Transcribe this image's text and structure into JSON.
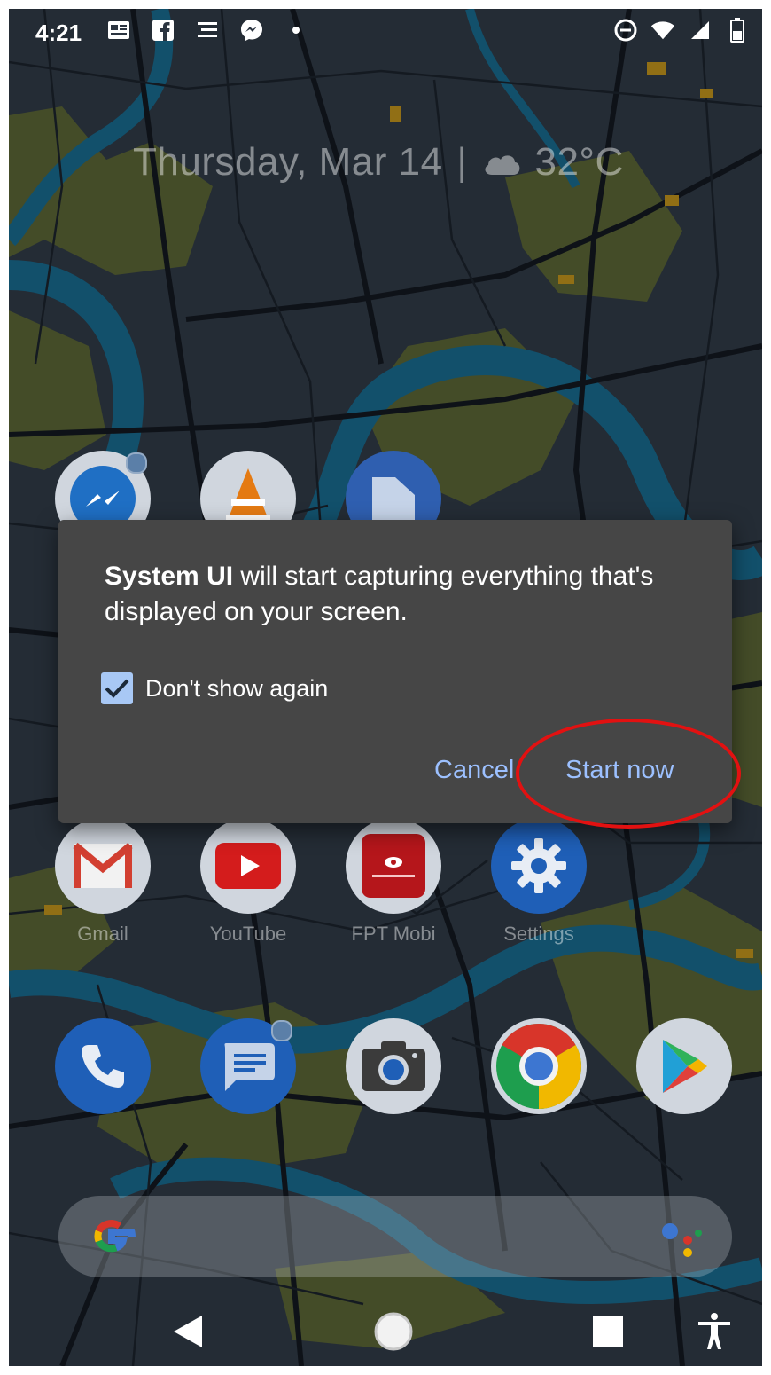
{
  "status_bar": {
    "time": "4:21",
    "left_icons": [
      "news-icon",
      "facebook-icon",
      "notes-icon",
      "messenger-icon",
      "dot-icon"
    ],
    "right_icons": [
      "do-not-disturb-icon",
      "wifi-icon",
      "signal-icon",
      "battery-icon"
    ]
  },
  "date_widget": {
    "date": "Thursday, Mar 14",
    "separator": "|",
    "weather_icon": "cloud-icon",
    "temperature": "32°C"
  },
  "apps": {
    "row1": [
      {
        "name": "Messenger",
        "icon": "messenger-icon",
        "color": "#1f6fc4"
      },
      {
        "name": "VLC",
        "icon": "vlc-icon",
        "color": "#d9d9d9"
      },
      {
        "name": "Files",
        "icon": "folder-icon",
        "color": "#2f5fb0"
      }
    ],
    "row2": [
      {
        "label": "Gmail",
        "icon": "gmail-icon",
        "color": "#d9d9d9"
      },
      {
        "label": "YouTube",
        "icon": "youtube-icon",
        "color": "#d9d9d9"
      },
      {
        "label": "FPT Mobi",
        "icon": "fpt-icon",
        "color": "#d9d9d9"
      },
      {
        "label": "Settings",
        "icon": "gear-icon",
        "color": "#1f5fb7"
      }
    ],
    "dock": [
      {
        "name": "Phone",
        "icon": "phone-icon",
        "color": "#1f5fb7"
      },
      {
        "name": "Messages",
        "icon": "messages-icon",
        "color": "#1f5fb7"
      },
      {
        "name": "Camera",
        "icon": "camera-icon",
        "color": "#d9d9d9"
      },
      {
        "name": "Chrome",
        "icon": "chrome-icon",
        "color": "#d9d9d9"
      },
      {
        "name": "Play Store",
        "icon": "play-store-icon",
        "color": "#d9d9d9"
      }
    ]
  },
  "dialog": {
    "app_name": "System UI",
    "message": " will start capturing everything that's displayed on your screen.",
    "checkbox_label": "Don't show again",
    "checkbox_checked": true,
    "cancel_label": "Cancel",
    "start_label": "Start now"
  },
  "search_bar": {
    "logo": "google-g-icon",
    "assistant": "assistant-icon"
  },
  "nav_bar": {
    "buttons": [
      "back-icon",
      "home-icon",
      "recents-icon",
      "accessibility-icon"
    ]
  },
  "colors": {
    "dialog_bg": "#464646",
    "accent": "#9cc0ff",
    "highlight": "#e21111",
    "river": "#1a6f95",
    "park": "#6e7a3a"
  }
}
